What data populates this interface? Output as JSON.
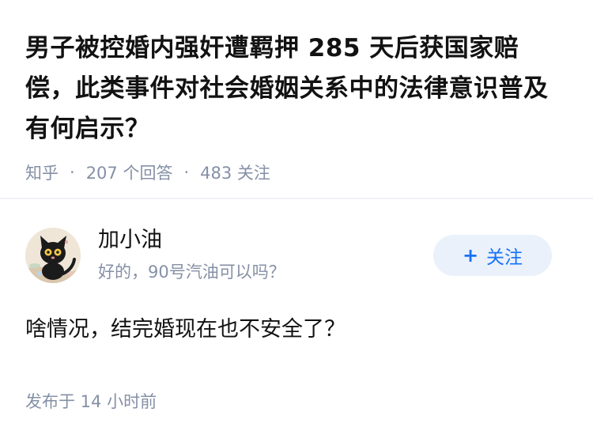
{
  "question": {
    "title": "男子被控婚内强奸遭羁押 285 天后获国家赔偿，此类事件对社会婚姻关系中的法律意识普及有何启示？",
    "source": "知乎",
    "separator": "·",
    "answer_count": "207 个回答",
    "follower_count": "483 关注"
  },
  "answer": {
    "author_name": "加小油",
    "author_bio": "好的，90号汽油可以吗？",
    "follow_plus": "+",
    "follow_label": "关注",
    "content": "啥情况，结完婚现在也不安全了？",
    "time": "发布于 14 小时前"
  },
  "colors": {
    "title_text": "#121212",
    "meta_text": "#8590a6",
    "follow_bg": "#eaf1fb",
    "follow_text": "#1772f6",
    "divider": "#f0f2f7"
  },
  "icons": {
    "avatar": "black-cat-avatar"
  }
}
